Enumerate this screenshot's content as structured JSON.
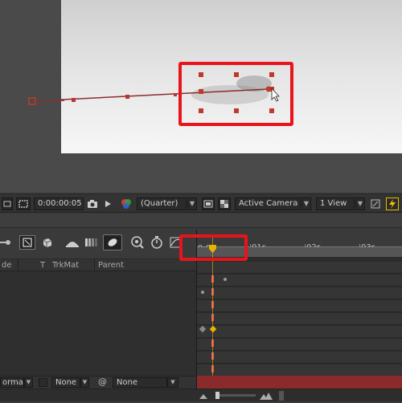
{
  "viewer_toolbar": {
    "timecode": "0:00:00:05",
    "resolution": "(Quarter)",
    "camera": "Active Camera",
    "view_layout": "1 View"
  },
  "timeline": {
    "layer_header": {
      "col_mode": "de",
      "col_t": "T",
      "col_trkmat": "TrkMat",
      "col_parent": "Parent"
    },
    "ruler": {
      "time_start": "0:00",
      "ticks": [
        "01s",
        "02s",
        "03s"
      ]
    },
    "bottom_bar": {
      "mode": "orma",
      "trkmat": "None",
      "parent": "None"
    }
  },
  "colors": {
    "highlight": "#e8141c",
    "keyframe": "#e05a5a",
    "motion_path": "#8b2d2d",
    "time_marker": "#e8b400"
  }
}
